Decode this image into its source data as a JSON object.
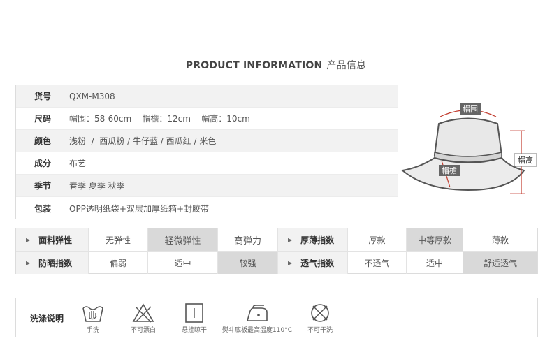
{
  "header": {
    "title_en": "PRODUCT INFORMATION",
    "title_cn": "产品信息"
  },
  "info": {
    "rows": [
      {
        "label": "货号",
        "value": "QXM-M308"
      },
      {
        "label": "尺码",
        "value": "帽围：58-60cm    帽檐：12cm    帽高：10cm"
      },
      {
        "label": "颜色",
        "value": "浅粉  /  西瓜粉 / 牛仔蓝 / 西瓜红 / 米色"
      },
      {
        "label": "成分",
        "value": "布艺"
      },
      {
        "label": "季节",
        "value": "春季 夏季 秋季"
      },
      {
        "label": "包装",
        "value": "OPP透明纸袋+双层加厚纸箱+封胶带"
      }
    ],
    "diagram": {
      "circumference": "帽围",
      "brim": "帽檐",
      "height": "帽高"
    }
  },
  "properties": {
    "row1": {
      "elastic_label": "面料弹性",
      "elastic_options": [
        "无弹性",
        "轻微弹性",
        "高弹力"
      ],
      "thickness_label": "厚薄指数",
      "thickness_options": [
        "厚款",
        "中等厚款",
        "薄款"
      ]
    },
    "row2": {
      "sun_label": "防晒指数",
      "sun_options": [
        "偏弱",
        "适中",
        "较强"
      ],
      "breath_label": "透气指数",
      "breath_options": [
        "不透气",
        "适中",
        "舒适透气"
      ]
    }
  },
  "wash": {
    "label": "洗涤说明",
    "items": [
      {
        "icon": "hand-wash-icon",
        "label": "手洗"
      },
      {
        "icon": "no-bleach-icon",
        "label": "不可漂白"
      },
      {
        "icon": "hang-dry-icon",
        "label": "悬挂晾干"
      },
      {
        "icon": "iron-icon",
        "label": "熨斗底板最高温度110°C"
      },
      {
        "icon": "no-dry-clean-icon",
        "label": "不可干洗"
      }
    ]
  }
}
